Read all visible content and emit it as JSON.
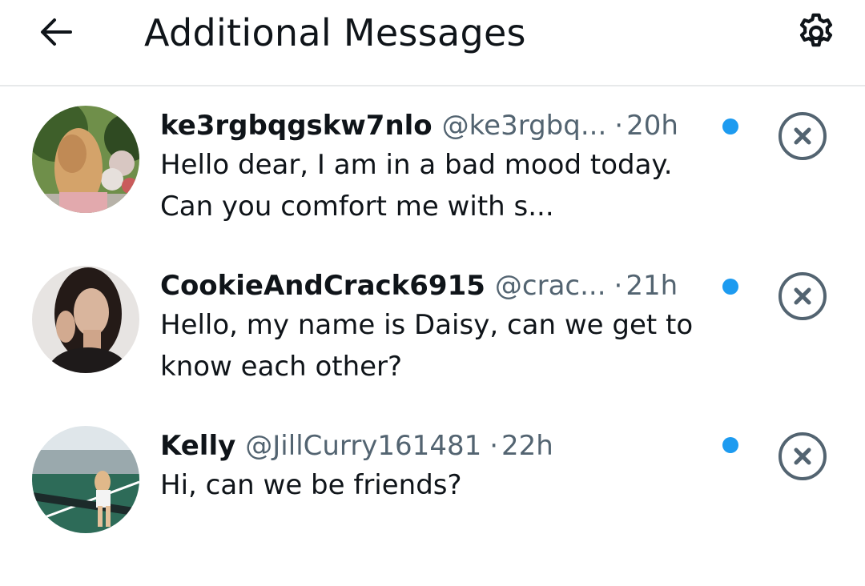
{
  "header": {
    "title": "Additional Messages",
    "back_icon": "arrow-left-icon",
    "settings_icon": "gear-icon"
  },
  "colors": {
    "unread_dot": "#1d9bf0",
    "secondary_text": "#536471",
    "divider": "#e7e9ea"
  },
  "messages": [
    {
      "name": "ke3rgbqgskw7nlo",
      "handle": "@ke3rgbq...",
      "separator": "·",
      "time": "20h",
      "text": "Hello dear, I am in a bad mood today. Can you comfort me with s...",
      "unread": true
    },
    {
      "name": "CookieAndCrack6915",
      "handle": "@crac...",
      "separator": "·",
      "time": "21h",
      "text": "Hello, my name is Daisy, can we get to know each other?",
      "unread": true
    },
    {
      "name": "Kelly",
      "handle": "@JillCurry161481",
      "separator": "·",
      "time": "22h",
      "text": "Hi, can we be friends?",
      "unread": true
    }
  ]
}
